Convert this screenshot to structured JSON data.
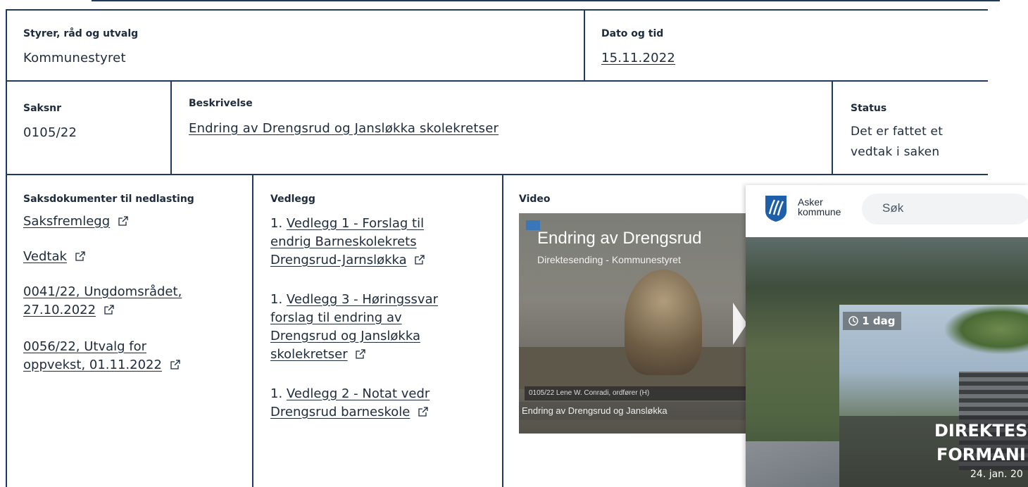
{
  "meeting": {
    "board_label": "Styrer, råd og utvalg",
    "board_value": "Kommunestyret",
    "date_label": "Dato og tid",
    "date_value": "15.11.2022"
  },
  "case": {
    "number_label": "Saksnr",
    "number_value": "0105/22",
    "description_label": "Beskrivelse",
    "description_value": "Endring av Drengsrud og Jansløkka skolekretser",
    "status_label": "Status",
    "status_line1": "Det er fattet et",
    "status_line2": "vedtak i saken"
  },
  "documents": {
    "label": "Saksdokumenter til nedlasting",
    "items": [
      {
        "text": "Saksfremlegg"
      },
      {
        "text": "Vedtak"
      },
      {
        "line1": "0041/22, Ungdomsrådet,",
        "line2": "27.10.2022"
      },
      {
        "line1": "0056/22, Utvalg for",
        "line2": "oppvekst, 01.11.2022"
      }
    ]
  },
  "attachments": {
    "label": "Vedlegg",
    "items": [
      {
        "prefix": "1.",
        "lines": [
          "Vedlegg 1 - Forslag til",
          "endrig Barneskolekrets",
          "Drengsrud-Jarnsløkka"
        ]
      },
      {
        "prefix": "1.",
        "lines": [
          "Vedlegg 3 - Høringssvar",
          "forslag til endring av",
          "Drengsrud og Jansløkka",
          "skolekretser"
        ]
      },
      {
        "prefix": "1.",
        "lines": [
          "Vedlegg 2 - Notat vedr",
          "Drengsrud barneskole"
        ]
      }
    ]
  },
  "video": {
    "label": "Video",
    "title": "Endring av Drengsrud",
    "subtitle": "Direktesending - Kommunestyret",
    "lower_third": "0105/22   Lene W. Conradi, ordfører (H)",
    "caption": "Endring av Drengsrud og Jansløkka"
  },
  "overlay": {
    "brand_line1": "Asker",
    "brand_line2": "kommune",
    "search_placeholder": "Søk",
    "badge": "1 dag",
    "headline1": "DIREKTESI",
    "headline2": "FORMANI",
    "date": "24. jan. 20"
  },
  "colors": {
    "border": "#1f3a5a",
    "text": "#1e2b3c",
    "brand_blue": "#1f5ea8"
  },
  "icons": [
    "external-link-icon",
    "asker-logo-icon",
    "clock-icon",
    "play-icon"
  ]
}
